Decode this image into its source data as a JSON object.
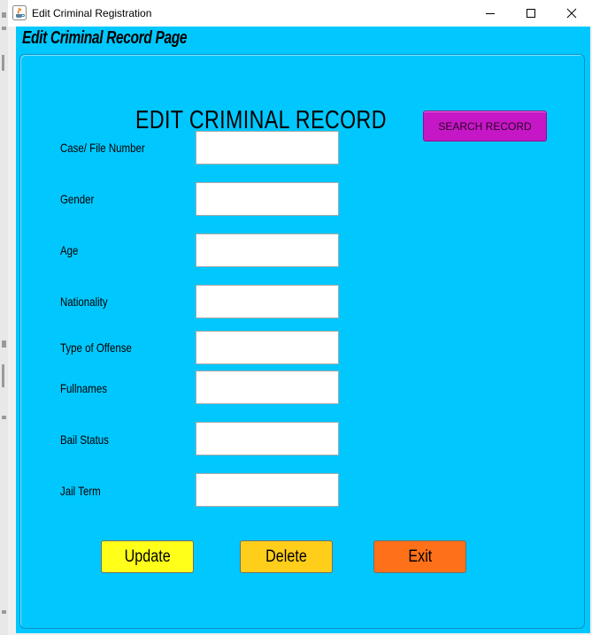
{
  "window": {
    "title": "Edit Criminal Registration",
    "header_label": "Edit Criminal  Record Page",
    "app_icon": "java-cup-icon",
    "controls": [
      "minimize-icon",
      "maximize-icon",
      "close-icon"
    ]
  },
  "form": {
    "title": "EDIT CRIMINAL RECORD",
    "search_button": "SEARCH RECORD",
    "fields": [
      {
        "label": "Case/ File Number",
        "value": ""
      },
      {
        "label": "Gender",
        "value": ""
      },
      {
        "label": "Age",
        "value": ""
      },
      {
        "label": "Nationality",
        "value": ""
      },
      {
        "label": "Type of Offense",
        "value": ""
      },
      {
        "label": "Fullnames",
        "value": ""
      },
      {
        "label": "Bail Status",
        "value": ""
      },
      {
        "label": "Jail Term",
        "value": ""
      }
    ],
    "buttons": {
      "update": "Update",
      "delete": "Delete",
      "exit": "Exit"
    }
  },
  "colors": {
    "background": "#00c8ff",
    "search_button": "#c617c6",
    "update_button": "#ffff1a",
    "delete_button": "#ffce1a",
    "exit_button": "#ff7119"
  }
}
